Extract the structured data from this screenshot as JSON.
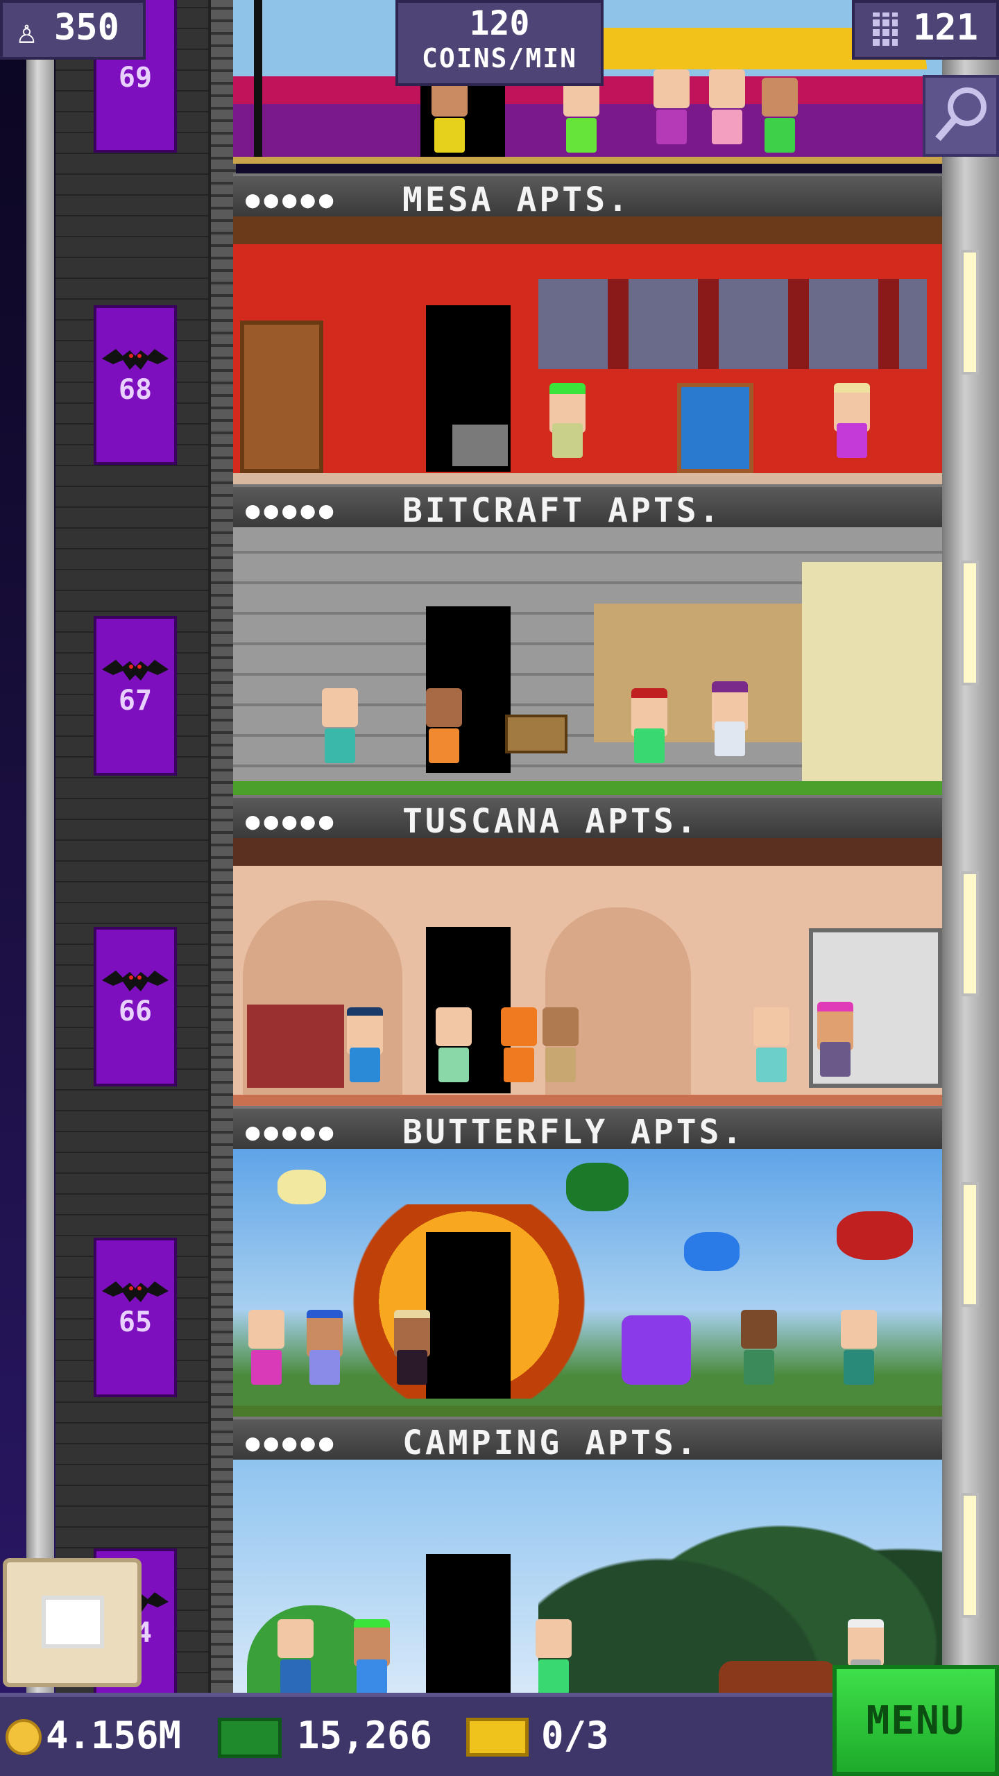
{
  "hud": {
    "population": "350",
    "coins_rate_value": "120",
    "coins_rate_label": "COINS/MIN",
    "floors": "121"
  },
  "elevator_floor_numbers": [
    "69",
    "68",
    "67",
    "66",
    "65",
    "64"
  ],
  "floors": [
    {
      "name": "MESA APTS.",
      "residents_icon": "●●●●●"
    },
    {
      "name": "BITCRAFT APTS.",
      "residents_icon": "●●●●●"
    },
    {
      "name": "TUSCANA APTS.",
      "residents_icon": "●●●●●"
    },
    {
      "name": "BUTTERFLY APTS.",
      "residents_icon": "●●●●●"
    },
    {
      "name": "CAMPING APTS.",
      "residents_icon": "●●●●●"
    }
  ],
  "bottom_bar": {
    "coins": "4.156M",
    "bux": "15,266",
    "tickets": "0/3",
    "menu_label": "MENU"
  },
  "colors": {
    "hud_bg": "#4e4476",
    "menu_green": "#2ecb3c",
    "elevator_purple": "#7d0fbf",
    "mesa_wall": "#d22a1c",
    "tuscana_wall": "#e8bfa2",
    "butterfly_sky": "#5fa4e8",
    "camping_sky": "#8fc4f0"
  }
}
